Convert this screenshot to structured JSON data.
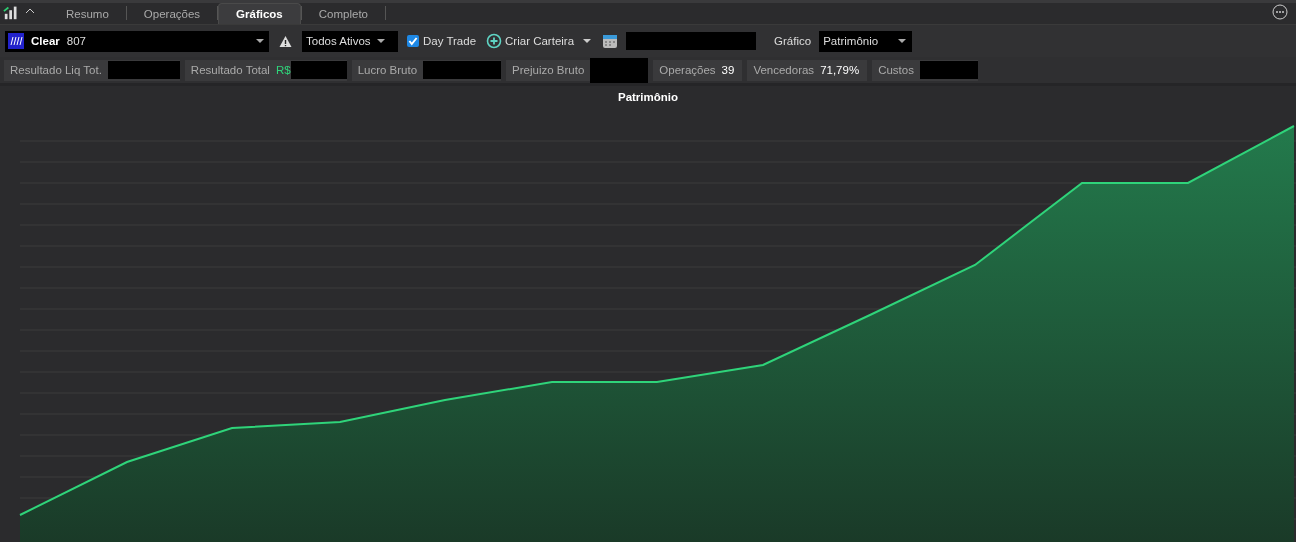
{
  "tabs": [
    {
      "label": "Resumo",
      "selected": false
    },
    {
      "label": "Operações",
      "selected": false
    },
    {
      "label": "Gráficos",
      "selected": true
    },
    {
      "label": "Completo",
      "selected": false
    }
  ],
  "toolbar": {
    "account": {
      "name": "Clear",
      "number": "807"
    },
    "assets_filter": "Todos Ativos",
    "day_trade": {
      "label": "Day Trade",
      "checked": true
    },
    "create_portfolio": "Criar Carteira",
    "chart_label": "Gráfico",
    "chart_select": "Patrimônio"
  },
  "stats": [
    {
      "label": "Resultado Liq Tot.",
      "redacted": true
    },
    {
      "label": "Resultado Total",
      "value": "R$",
      "redacted": true
    },
    {
      "label": "Lucro Bruto",
      "redacted": true
    },
    {
      "label": "Prejuizo Bruto",
      "redacted": true
    },
    {
      "label": "Operações",
      "value": "39",
      "redacted": false
    },
    {
      "label": "Vencedoras",
      "value": "71,79%",
      "redacted": false
    },
    {
      "label": "Custos",
      "redacted": true
    }
  ],
  "chart": {
    "title": "Patrimônio"
  }
}
